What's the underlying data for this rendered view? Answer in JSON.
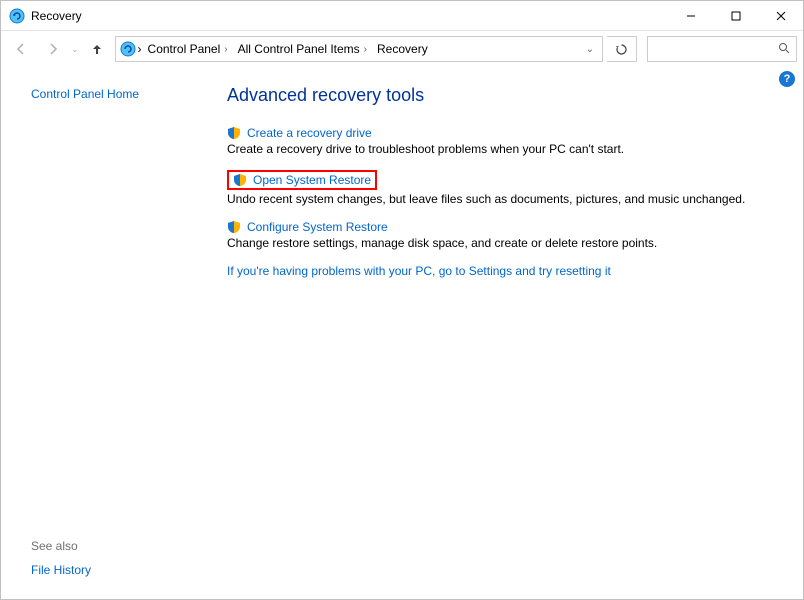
{
  "window": {
    "title": "Recovery"
  },
  "breadcrumbs": {
    "items": [
      "Control Panel",
      "All Control Panel Items",
      "Recovery"
    ]
  },
  "search": {
    "placeholder": ""
  },
  "sidebar": {
    "home": "Control Panel Home",
    "see_also": "See also",
    "file_history": "File History"
  },
  "main": {
    "title": "Advanced recovery tools",
    "tools": [
      {
        "link": "Create a recovery drive",
        "desc": "Create a recovery drive to troubleshoot problems when your PC can't start."
      },
      {
        "link": "Open System Restore",
        "desc": "Undo recent system changes, but leave files such as documents, pictures, and music unchanged."
      },
      {
        "link": "Configure System Restore",
        "desc": "Change restore settings, manage disk space, and create or delete restore points."
      }
    ],
    "help_line": "If you're having problems with your PC, go to Settings and try resetting it"
  },
  "help_icon": "?"
}
